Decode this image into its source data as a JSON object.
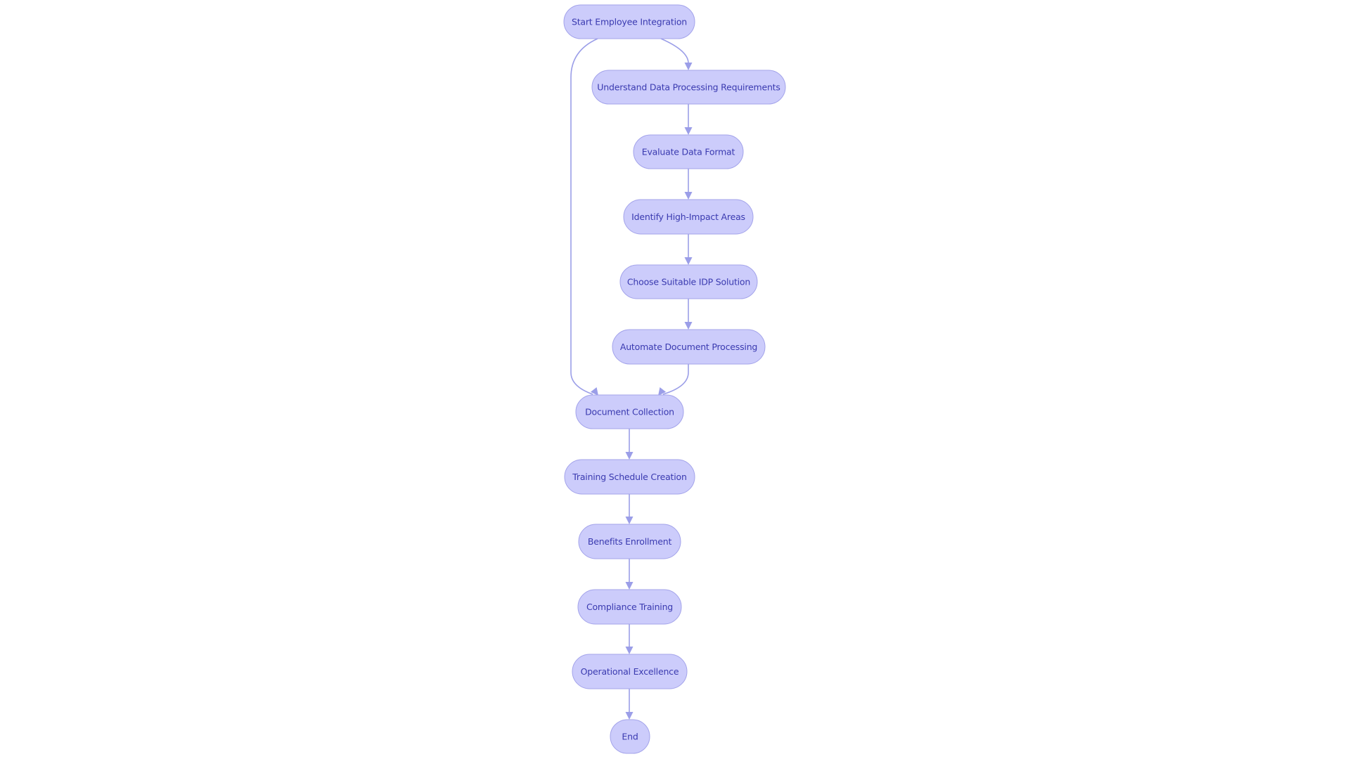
{
  "diagram": {
    "type": "flowchart",
    "direction": "top-down",
    "colors": {
      "node_fill": "#ccccfb",
      "node_stroke": "#a3a3ea",
      "node_text": "#3a3ab0",
      "edge": "#9b9ee8"
    },
    "nodes": [
      {
        "id": "start",
        "label": "Start Employee Integration"
      },
      {
        "id": "understand",
        "label": "Understand Data Processing Requirements"
      },
      {
        "id": "evaluate",
        "label": "Evaluate Data Format"
      },
      {
        "id": "identify",
        "label": "Identify High-Impact Areas"
      },
      {
        "id": "choose",
        "label": "Choose Suitable IDP Solution"
      },
      {
        "id": "automate",
        "label": "Automate Document Processing"
      },
      {
        "id": "doccollect",
        "label": "Document Collection"
      },
      {
        "id": "training",
        "label": "Training Schedule Creation"
      },
      {
        "id": "benefits",
        "label": "Benefits Enrollment"
      },
      {
        "id": "compliance",
        "label": "Compliance Training"
      },
      {
        "id": "opex",
        "label": "Operational Excellence"
      },
      {
        "id": "end",
        "label": "End"
      }
    ],
    "edges": [
      {
        "from": "start",
        "to": "understand"
      },
      {
        "from": "start",
        "to": "doccollect"
      },
      {
        "from": "understand",
        "to": "evaluate"
      },
      {
        "from": "evaluate",
        "to": "identify"
      },
      {
        "from": "identify",
        "to": "choose"
      },
      {
        "from": "choose",
        "to": "automate"
      },
      {
        "from": "automate",
        "to": "doccollect"
      },
      {
        "from": "doccollect",
        "to": "training"
      },
      {
        "from": "training",
        "to": "benefits"
      },
      {
        "from": "benefits",
        "to": "compliance"
      },
      {
        "from": "compliance",
        "to": "opex"
      },
      {
        "from": "opex",
        "to": "end"
      }
    ]
  }
}
